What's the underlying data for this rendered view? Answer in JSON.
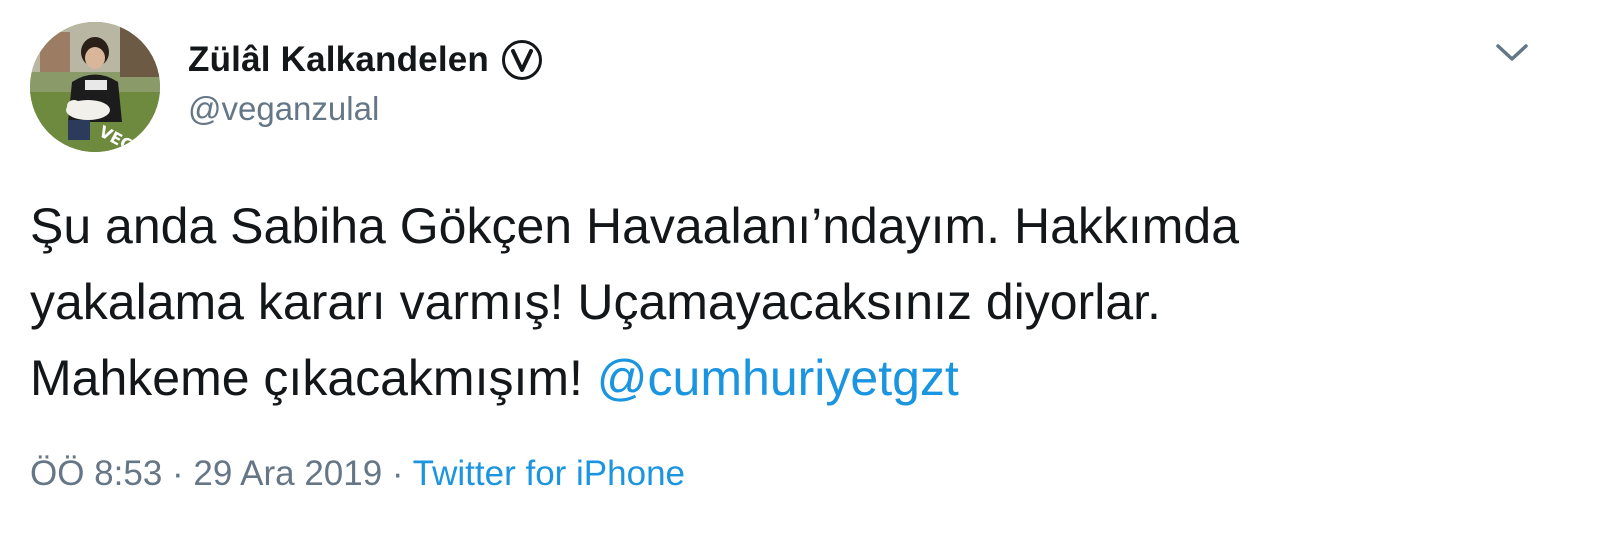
{
  "user": {
    "display_name": "Zülâl Kalkandelen",
    "handle": "@veganzulal",
    "verified_badge_icon": "circled-v-badge-icon",
    "avatar_text": "VEGAN"
  },
  "tweet": {
    "text_line1": "Şu anda Sabiha Gökçen Havaalanı’ndayım. Hakkımda",
    "text_line2": "yakalama kararı varmış! Uçamayacaksınız diyorlar.",
    "text_line3": "Mahkeme çıkacakmışım! ",
    "mention": "@cumhuriyetgzt"
  },
  "meta": {
    "time": "ÖÖ 8:53",
    "separator1": " · ",
    "date": "29 Ara 2019",
    "separator2": " · ",
    "source": "Twitter for iPhone"
  },
  "colors": {
    "text": "#14171a",
    "secondary": "#657786",
    "link": "#1b95e0"
  },
  "icons": {
    "menu": "chevron-down-icon"
  }
}
